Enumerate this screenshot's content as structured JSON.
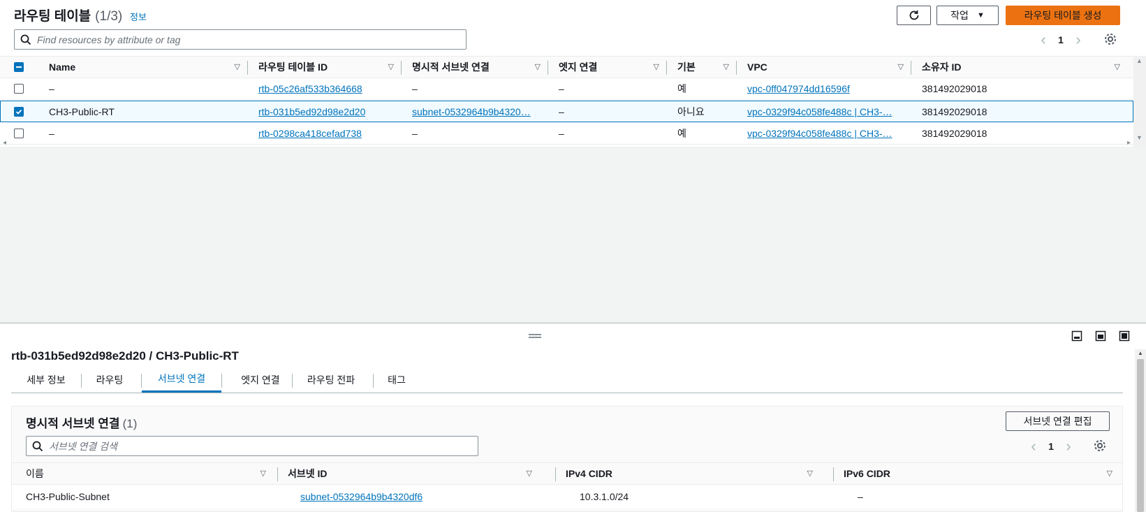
{
  "header": {
    "title": "라우팅 테이블",
    "count": "(1/3)",
    "info": "정보",
    "actions_label": "작업",
    "create_label": "라우팅 테이블 생성",
    "search_placeholder": "Find resources by attribute or tag",
    "page": "1"
  },
  "table": {
    "columns": [
      "Name",
      "라우팅 테이블 ID",
      "명시적 서브넷 연결",
      "엣지 연결",
      "기본",
      "VPC",
      "소유자 ID"
    ],
    "rows": [
      {
        "name": "–",
        "rtb_id": "rtb-05c26af533b364668",
        "subnet": "–",
        "edge": "–",
        "main": "예",
        "vpc": "vpc-0ff047974dd16596f",
        "owner": "381492029018",
        "selected": false
      },
      {
        "name": "CH3-Public-RT",
        "rtb_id": "rtb-031b5ed92d98e2d20",
        "subnet": "subnet-0532964b9b4320…",
        "edge": "–",
        "main": "아니요",
        "vpc": "vpc-0329f94c058fe488c | CH3-…",
        "owner": "381492029018",
        "selected": true
      },
      {
        "name": "–",
        "rtb_id": "rtb-0298ca418cefad738",
        "subnet": "–",
        "edge": "–",
        "main": "예",
        "vpc": "vpc-0329f94c058fe488c | CH3-…",
        "owner": "381492029018",
        "selected": false
      }
    ]
  },
  "detail": {
    "title": "rtb-031b5ed92d98e2d20 / CH3-Public-RT",
    "tabs": [
      "세부 정보",
      "라우팅",
      "서브넷 연결",
      "엣지 연결",
      "라우팅 전파",
      "태그"
    ],
    "active_tab": "서브넷 연결",
    "section_title": "명시적 서브넷 연결",
    "section_count": "(1)",
    "edit_label": "서브넷 연결 편집",
    "search_placeholder": "서브넷 연결 검색",
    "page": "1",
    "columns": [
      "이름",
      "서브넷 ID",
      "IPv4 CIDR",
      "IPv6 CIDR"
    ],
    "row": {
      "name": "CH3-Public-Subnet",
      "subnet_id": "subnet-0532964b9b4320df6",
      "ipv4": "10.3.1.0/24",
      "ipv6": "–"
    }
  },
  "colors": {
    "accent": "#0073bb",
    "primary_button": "#ec7211"
  }
}
